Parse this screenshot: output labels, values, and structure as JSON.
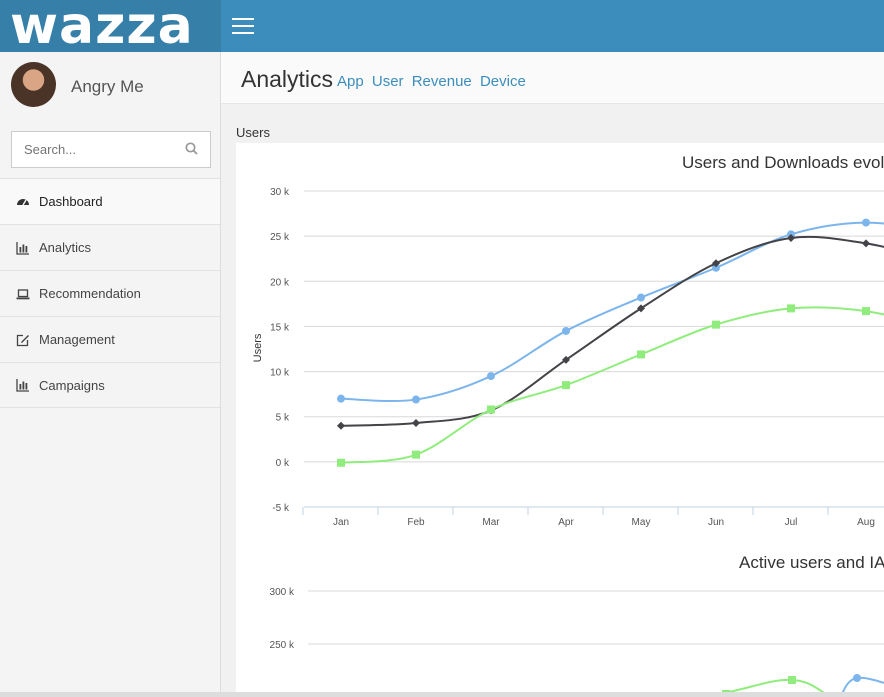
{
  "brand": {
    "logo_text": "wazza",
    "accent": "#3c8dbc"
  },
  "user": {
    "name": "Angry Me"
  },
  "search": {
    "placeholder": "Search..."
  },
  "sidebar": {
    "items": [
      {
        "label": "Dashboard",
        "icon": "dashboard-icon",
        "active": true
      },
      {
        "label": "Analytics",
        "icon": "bar-chart-icon",
        "active": false
      },
      {
        "label": "Recommendation",
        "icon": "laptop-icon",
        "active": false
      },
      {
        "label": "Management",
        "icon": "edit-icon",
        "active": false
      },
      {
        "label": "Campaigns",
        "icon": "bar-chart-icon",
        "active": false
      }
    ]
  },
  "header": {
    "title": "Analytics",
    "links": [
      "App",
      "User",
      "Revenue",
      "Device"
    ]
  },
  "section": {
    "label": "Users"
  },
  "chart_data": [
    {
      "type": "line",
      "title": "Users and Downloads evolu",
      "ylabel": "Users",
      "categories": [
        "Jan",
        "Feb",
        "Mar",
        "Apr",
        "May",
        "Jun",
        "Jul",
        "Aug"
      ],
      "yticks": [
        "30 k",
        "25 k",
        "20 k",
        "15 k",
        "10 k",
        "5 k",
        "0 k",
        "-5 k"
      ],
      "ylim": [
        -5000,
        30000
      ],
      "grid": true,
      "series": [
        {
          "color": "#7cb5ec",
          "marker": "circle",
          "values": [
            7000,
            6900,
            9500,
            14500,
            18200,
            21500,
            25200,
            26500
          ]
        },
        {
          "color": "#434348",
          "marker": "diamond",
          "values": [
            4000,
            4300,
            5700,
            11300,
            17000,
            22000,
            24800,
            24200
          ]
        },
        {
          "color": "#90ed7d",
          "marker": "square",
          "values": [
            -100,
            800,
            5800,
            8500,
            11900,
            15200,
            17000,
            16700
          ]
        }
      ]
    },
    {
      "type": "line",
      "title": "Active users and IAF",
      "ylabel": "",
      "yticks": [
        "300 k",
        "250 k"
      ],
      "series": []
    }
  ]
}
